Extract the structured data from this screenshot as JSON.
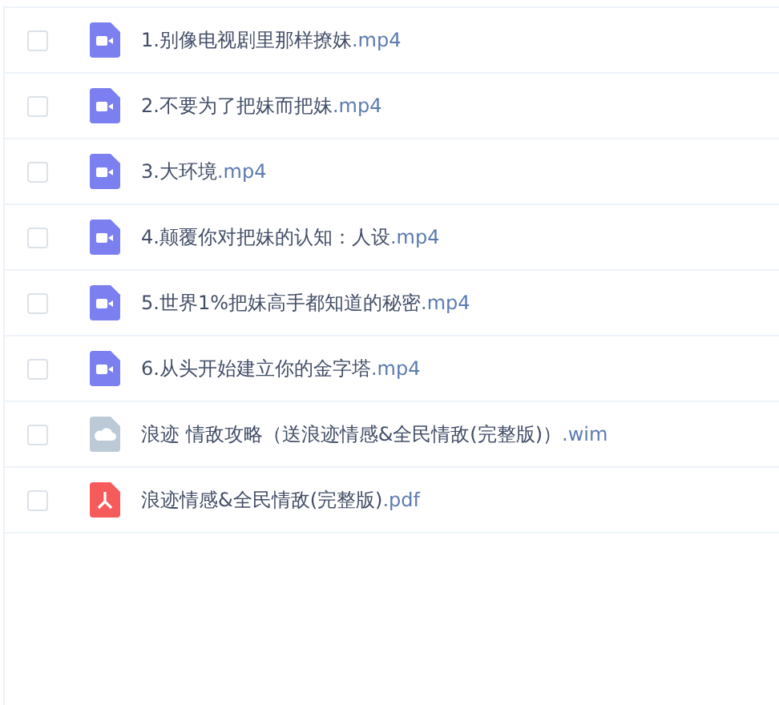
{
  "files": [
    {
      "kind": "video",
      "checked": false,
      "name": "1.别像电视剧里那样撩妹",
      "ext": ".mp4"
    },
    {
      "kind": "video",
      "checked": false,
      "name": "2.不要为了把妹而把妹",
      "ext": ".mp4"
    },
    {
      "kind": "video",
      "checked": false,
      "name": "3.大环境",
      "ext": ".mp4"
    },
    {
      "kind": "video",
      "checked": false,
      "name": "4.颠覆你对把妹的认知：人设",
      "ext": ".mp4"
    },
    {
      "kind": "video",
      "checked": false,
      "name": "5.世界1%把妹高手都知道的秘密",
      "ext": ".mp4"
    },
    {
      "kind": "video",
      "checked": false,
      "name": "6.从头开始建立你的金字塔",
      "ext": ".mp4"
    },
    {
      "kind": "cloud",
      "checked": false,
      "name": "浪迹 情敌攻略（送浪迹情感&全民情敌(完整版)）",
      "ext": ".wim"
    },
    {
      "kind": "pdf",
      "checked": false,
      "name": "浪迹情感&全民情敌(完整版)",
      "ext": ".pdf"
    }
  ]
}
